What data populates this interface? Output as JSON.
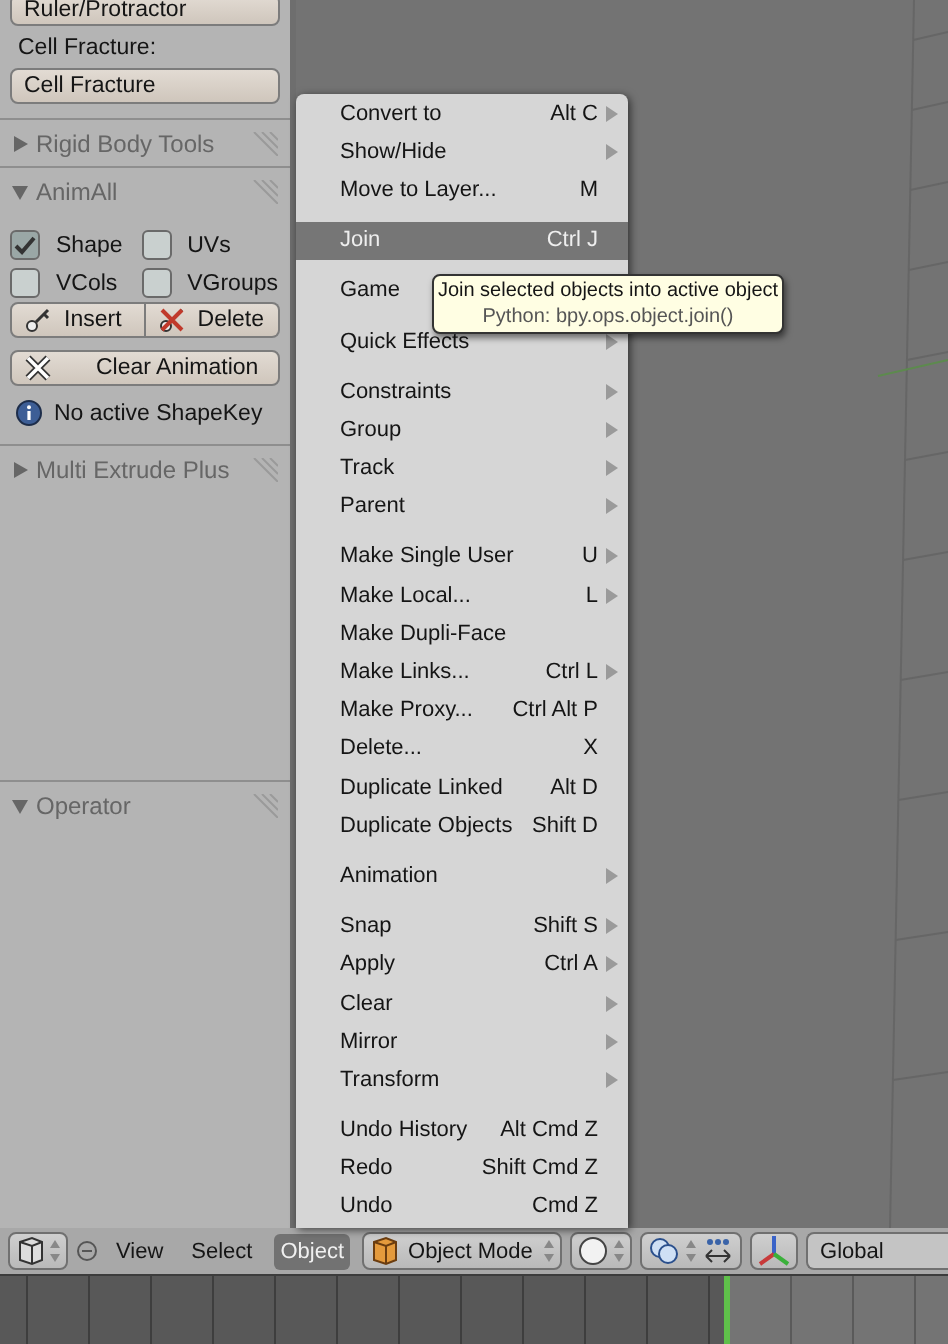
{
  "tool_panel": {
    "top_button": "Ruler/Protractor",
    "cell_fracture_label": "Cell Fracture:",
    "cell_fracture_button": "Cell Fracture",
    "rigid_body_tools": {
      "title": "Rigid Body Tools",
      "expanded": false
    },
    "animall": {
      "title": "AnimAll",
      "expanded": true,
      "options": [
        {
          "label": "Shape",
          "checked": true
        },
        {
          "label": "UVs",
          "checked": false
        },
        {
          "label": "VCols",
          "checked": false
        },
        {
          "label": "VGroups",
          "checked": false
        }
      ],
      "insert_button": "Insert",
      "delete_button": "Delete",
      "clear_button": "Clear Animation",
      "info": "No active ShapeKey"
    },
    "multi_extrude_plus": {
      "title": "Multi Extrude Plus",
      "expanded": false
    },
    "operator": {
      "title": "Operator",
      "expanded": true
    }
  },
  "object_menu": {
    "groups": [
      [
        {
          "label": "Convert to",
          "shortcut": "Alt C",
          "submenu": true,
          "selected": false
        },
        {
          "label": "Show/Hide",
          "submenu": true,
          "selected": false
        },
        {
          "label": "Move to Layer...",
          "shortcut": "M",
          "submenu": false,
          "selected": false
        }
      ],
      [
        {
          "label": "Join",
          "shortcut": "Ctrl J",
          "submenu": false,
          "selected": true
        }
      ],
      [
        {
          "label": "Game",
          "submenu": false,
          "selected": false
        }
      ],
      [
        {
          "label": "Quick Effects",
          "submenu": true,
          "selected": false
        }
      ],
      [
        {
          "label": "Constraints",
          "submenu": true,
          "selected": false
        },
        {
          "label": "Group",
          "submenu": true,
          "selected": false
        },
        {
          "label": "Track",
          "submenu": true,
          "selected": false
        },
        {
          "label": "Parent",
          "submenu": true,
          "selected": false
        }
      ],
      [
        {
          "label": "Make Single User",
          "shortcut": "U",
          "submenu": true,
          "selected": false
        },
        {
          "label": "Make Local...",
          "shortcut": "L",
          "submenu": true,
          "selected": false
        },
        {
          "label": "Make Dupli-Face",
          "submenu": false,
          "selected": false
        },
        {
          "label": "Make Links...",
          "shortcut": "Ctrl L",
          "submenu": true,
          "selected": false
        },
        {
          "label": "Make Proxy...",
          "shortcut": "Ctrl Alt P",
          "submenu": false,
          "selected": false
        },
        {
          "label": "Delete...",
          "shortcut": "X",
          "submenu": false,
          "selected": false
        },
        {
          "label": "Duplicate Linked",
          "shortcut": "Alt D",
          "submenu": false,
          "selected": false
        },
        {
          "label": "Duplicate Objects",
          "shortcut": "Shift D",
          "submenu": false,
          "selected": false
        }
      ],
      [
        {
          "label": "Animation",
          "submenu": true,
          "selected": false
        }
      ],
      [
        {
          "label": "Snap",
          "shortcut": "Shift S",
          "submenu": true,
          "selected": false
        },
        {
          "label": "Apply",
          "shortcut": "Ctrl A",
          "submenu": true,
          "selected": false
        },
        {
          "label": "Clear",
          "submenu": true,
          "selected": false
        },
        {
          "label": "Mirror",
          "submenu": true,
          "selected": false
        },
        {
          "label": "Transform",
          "submenu": true,
          "selected": false
        }
      ],
      [
        {
          "label": "Undo History",
          "shortcut": "Alt Cmd Z",
          "submenu": false,
          "selected": false
        },
        {
          "label": "Redo",
          "shortcut": "Shift Cmd Z",
          "submenu": false,
          "selected": false
        },
        {
          "label": "Undo",
          "shortcut": "Cmd Z",
          "submenu": false,
          "selected": false
        }
      ]
    ]
  },
  "tooltip": {
    "description": "Join selected objects into active object",
    "python": "Python: bpy.ops.object.join()"
  },
  "header": {
    "menus": [
      {
        "label": "View",
        "selected": false
      },
      {
        "label": "Select",
        "selected": false
      },
      {
        "label": "Object",
        "selected": true
      }
    ],
    "mode": "Object Mode",
    "orientation": "Global"
  }
}
